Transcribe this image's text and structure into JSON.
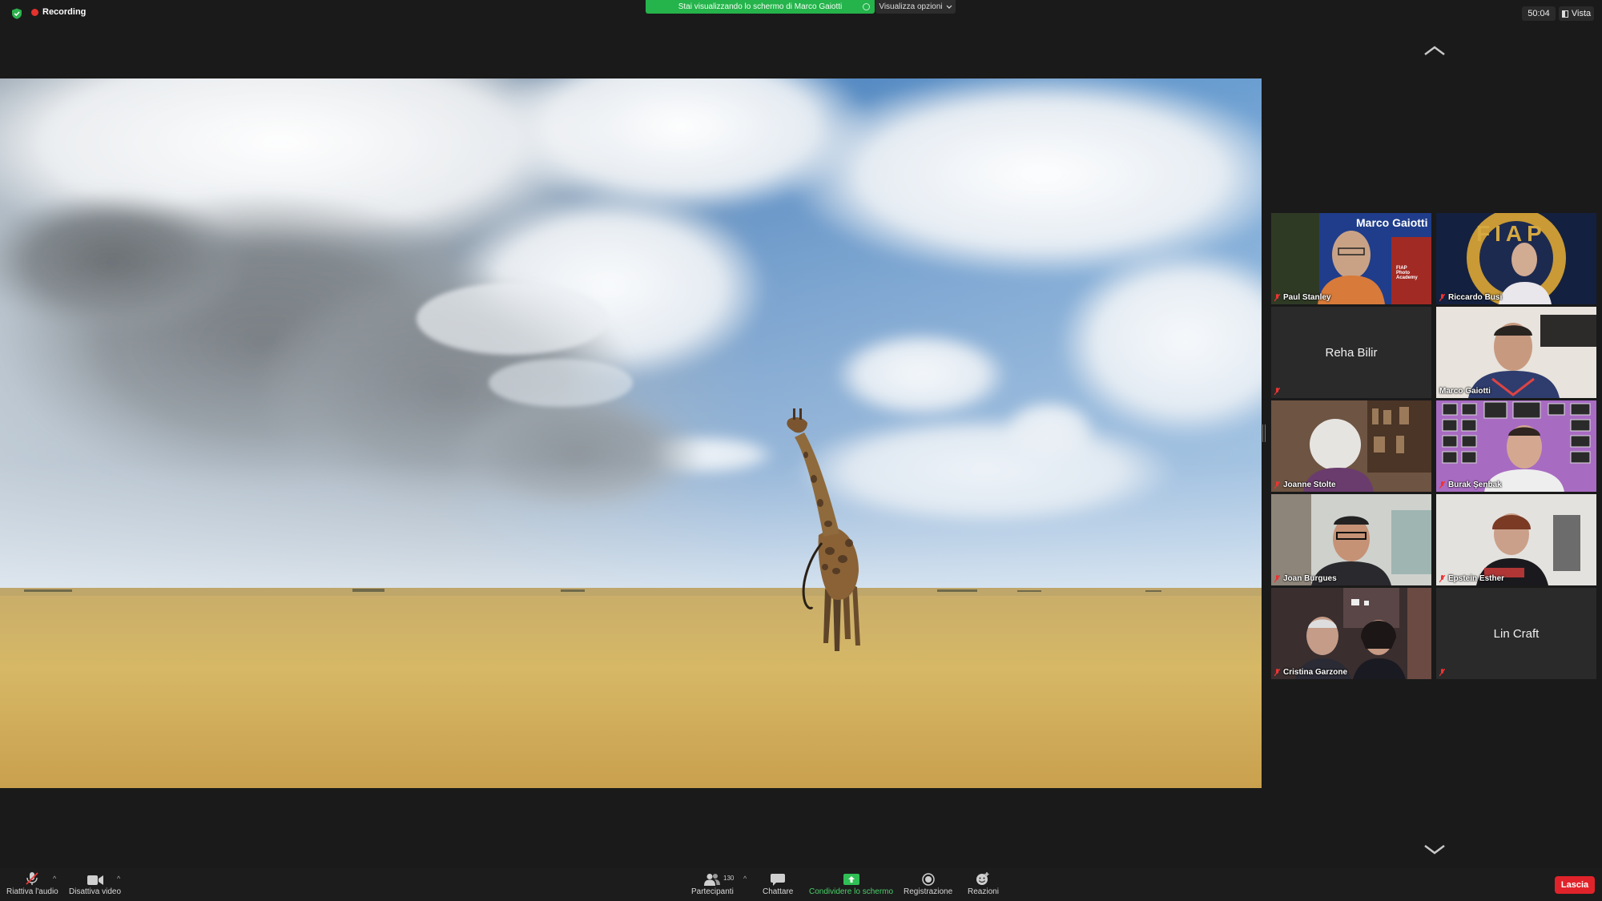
{
  "topbar": {
    "recording_label": "Recording",
    "share_banner": "Stai visualizzando lo schermo di Marco Gaiotti",
    "view_options": "Visualizza opzioni",
    "timer": "50:04",
    "view_label": "Vista"
  },
  "gallery": {
    "tiles": [
      {
        "name": "Paul Stanley",
        "overlay_title": "Marco Gaiotti",
        "overlay_sub": "FIAP Photo Academy"
      },
      {
        "name": "Riccardo Busi",
        "overlay_title": "FIAP"
      },
      {
        "name": "Reha Bilir"
      },
      {
        "name": "Marco Gaiotti"
      },
      {
        "name": "Joanne Stolte"
      },
      {
        "name": "Burak Şenbak"
      },
      {
        "name": "Joan Burgues"
      },
      {
        "name": "Epstein Esther"
      },
      {
        "name": "Cristina Garzone"
      },
      {
        "name": "Lin Craft"
      }
    ]
  },
  "toolbar": {
    "audio_label": "Riattiva l'audio",
    "video_label": "Disattiva video",
    "participants_label": "Partecipanti",
    "participants_count": "130",
    "chat_label": "Chattare",
    "share_label": "Condividere lo schermo",
    "record_label": "Registrazione",
    "reactions_label": "Reazioni",
    "leave_label": "Lascia"
  },
  "colors": {
    "share_green": "#25b34b",
    "leave_red": "#e0232a",
    "active_speaker": "#b9e455",
    "recording_red": "#e5322d"
  }
}
